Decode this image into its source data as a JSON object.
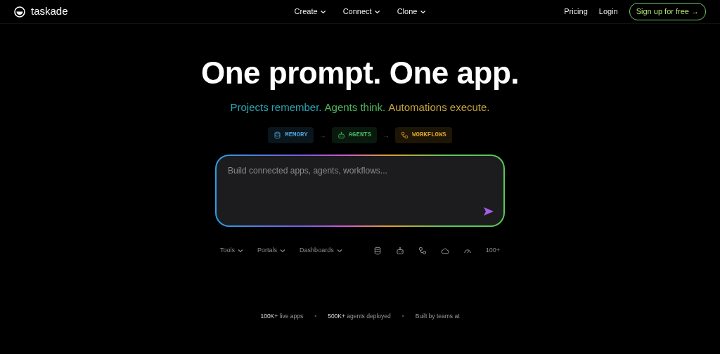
{
  "nav": {
    "logo": "taskade",
    "menus": [
      {
        "label": "Create"
      },
      {
        "label": "Connect"
      },
      {
        "label": "Clone"
      }
    ],
    "links": [
      "Pricing",
      "Login"
    ],
    "cta": "Sign up for free →"
  },
  "hero": {
    "title": "One prompt. One app.",
    "tagline": [
      {
        "text": "Projects remember.",
        "color": "#2aa6b4"
      },
      {
        "text": "Agents think.",
        "color": "#4cb85c"
      },
      {
        "text": "Automations execute.",
        "color": "#c3a33a"
      }
    ],
    "pills": [
      {
        "kind": "database",
        "label": "MEMORY",
        "color": "#4a9fd0"
      },
      {
        "kind": "robot",
        "label": "AGENTS",
        "color": "#46b862"
      },
      {
        "kind": "workflow",
        "label": "WORKFLOWS",
        "color": "#d9a22a"
      }
    ],
    "separator": "→"
  },
  "prompt": {
    "placeholder": "Build connected apps, agents, workflows..."
  },
  "toolbar": {
    "menus": [
      {
        "label": "Tools"
      },
      {
        "label": "Portals"
      },
      {
        "label": "Dashboards"
      }
    ],
    "icons": [
      {
        "kind": "database"
      },
      {
        "kind": "robot"
      },
      {
        "kind": "workflow"
      },
      {
        "kind": "cloud"
      },
      {
        "kind": "gauge"
      }
    ],
    "more": "100+"
  },
  "stats": [
    "**100K+** live apps",
    "**500K+** agents deployed",
    "Built by teams at"
  ],
  "stat_separator": "•"
}
